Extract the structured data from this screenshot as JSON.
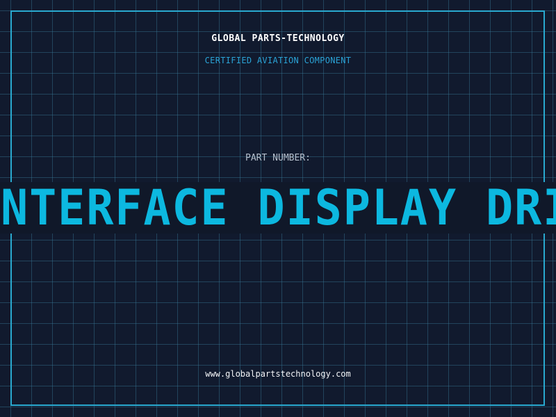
{
  "header": {
    "company": "GLOBAL PARTS-TECHNOLOGY",
    "certification": "CERTIFIED AVIATION COMPONENT"
  },
  "part": {
    "label": "PART NUMBER:",
    "value": "INTERFACE DISPLAY DRIVER"
  },
  "footer": {
    "website": "www.globalpartstechnology.com"
  },
  "colors": {
    "background": "#111a2e",
    "grid": "#2a5a78",
    "accent": "#0cb8e0",
    "frame": "#29a9cf"
  }
}
